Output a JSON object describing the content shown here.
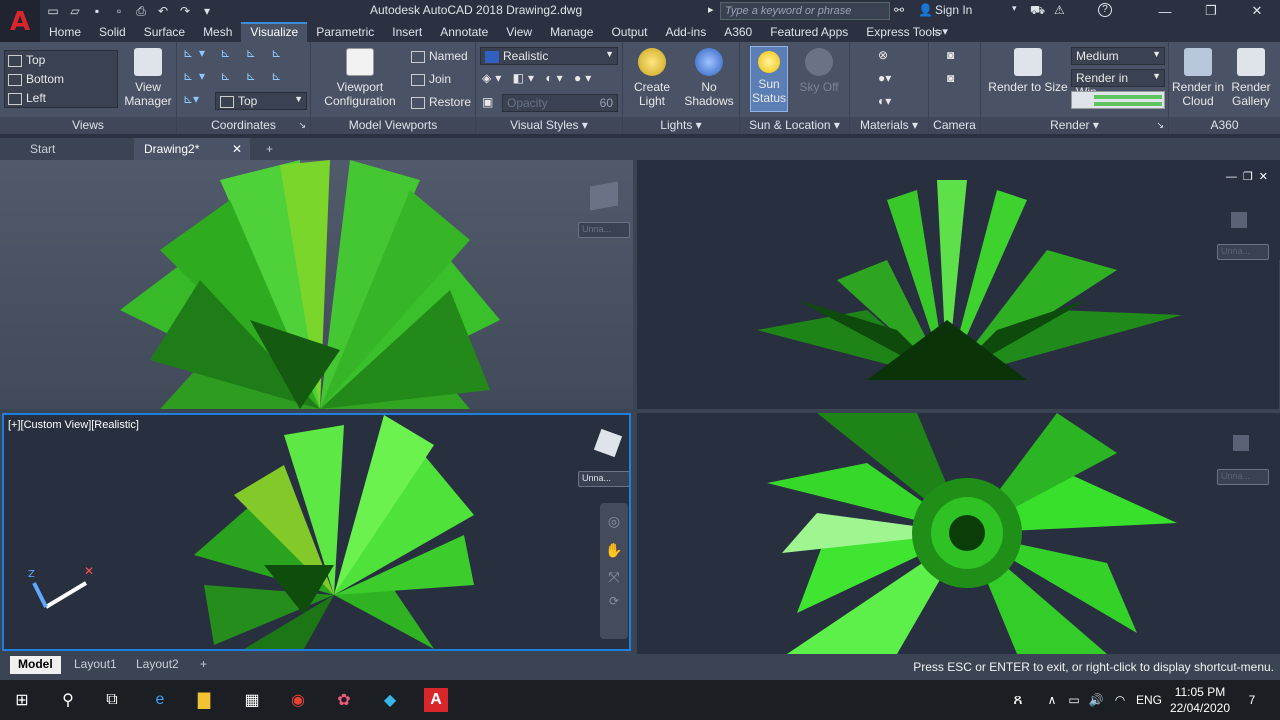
{
  "titlebar": {
    "title": "Autodesk AutoCAD 2018    Drawing2.dwg",
    "search_placeholder": "Type a keyword or phrase",
    "sign_in": "Sign In",
    "help": "?"
  },
  "tabs": [
    "Home",
    "Solid",
    "Surface",
    "Mesh",
    "Visualize",
    "Parametric",
    "Insert",
    "Annotate",
    "View",
    "Manage",
    "Output",
    "Add-ins",
    "A360",
    "Featured Apps",
    "Express Tools"
  ],
  "active_tab": "Visualize",
  "ribbon": {
    "views": {
      "label": "Views",
      "items": [
        "Top",
        "Bottom",
        "Left"
      ],
      "view_manager": "View\nManager"
    },
    "coordinates": {
      "label": "Coordinates",
      "ucs_combo": "Top"
    },
    "model_viewports": {
      "label": "Model Viewports",
      "config": "Viewport\nConfiguration",
      "named": "Named",
      "join": "Join",
      "restore": "Restore"
    },
    "visual_styles": {
      "label": "Visual Styles",
      "combo": "Realistic",
      "opacity_label": "Opacity",
      "opacity_value": "60"
    },
    "lights": {
      "label": "Lights",
      "create_light": "Create\nLight",
      "no_shadows": "No\nShadows"
    },
    "sun_location": {
      "label": "Sun & Location",
      "sun_status": "Sun\nStatus",
      "sky_off": "Sky Off"
    },
    "materials": {
      "label": "Materials"
    },
    "camera": {
      "label": "Camera"
    },
    "render": {
      "label": "Render",
      "render_to_size": "Render to Size",
      "quality": "Medium",
      "render_in": "Render in Win..."
    },
    "a360": {
      "label": "A360",
      "render_in_cloud": "Render in\nCloud",
      "render_gallery": "Render\nGallery"
    }
  },
  "file_tabs": {
    "start": "Start",
    "drawing": "Drawing2*"
  },
  "viewports": {
    "active_label": "[+][Custom View][Realistic]",
    "unnamed": "Unna..."
  },
  "layout_tabs": [
    "Model",
    "Layout1",
    "Layout2"
  ],
  "command_message": "Press ESC or ENTER to exit, or right-click to display shortcut-menu.",
  "taskbar": {
    "language": "ENG",
    "time": "11:05 PM",
    "date": "22/04/2020",
    "notifications": "7"
  },
  "colors": {
    "accent": "#1f7fe0",
    "plant_green": "#2fd11c",
    "brand_red": "#d8262a"
  }
}
